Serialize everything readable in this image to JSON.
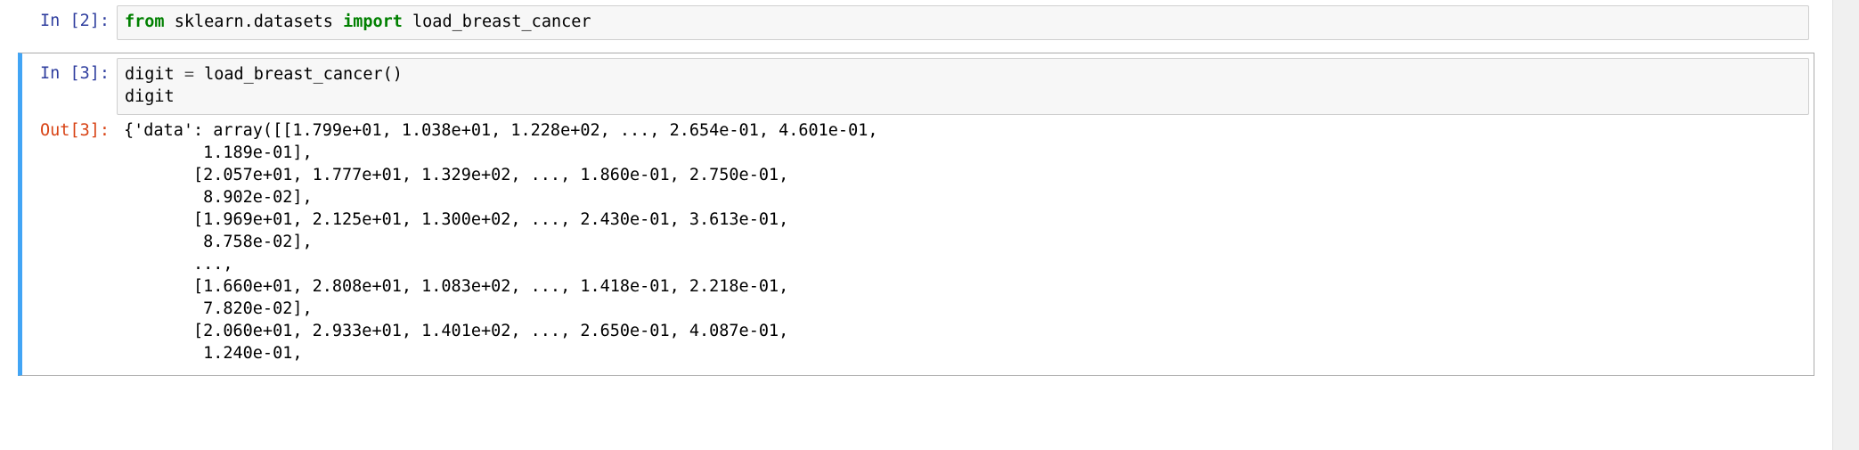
{
  "cells": [
    {
      "prompt_in": "In [2]:",
      "code_tokens": {
        "from": "from",
        "module": "sklearn.datasets",
        "import": "import",
        "name": "load_breast_cancer"
      }
    },
    {
      "prompt_in": "In [3]:",
      "code_line1_left": "digit ",
      "code_line1_op": "=",
      "code_line1_right": " load_breast_cancer()",
      "code_line2": "digit",
      "prompt_out": "Out[3]:",
      "output": "{'data': array([[1.799e+01, 1.038e+01, 1.228e+02, ..., 2.654e-01, 4.601e-01,\n        1.189e-01],\n       [2.057e+01, 1.777e+01, 1.329e+02, ..., 1.860e-01, 2.750e-01,\n        8.902e-02],\n       [1.969e+01, 2.125e+01, 1.300e+02, ..., 2.430e-01, 3.613e-01,\n        8.758e-02],\n       ...,\n       [1.660e+01, 2.808e+01, 1.083e+02, ..., 1.418e-01, 2.218e-01,\n        7.820e-02],\n       [2.060e+01, 2.933e+01, 1.401e+02, ..., 2.650e-01, 4.087e-01,\n        1.240e-01,"
    }
  ]
}
